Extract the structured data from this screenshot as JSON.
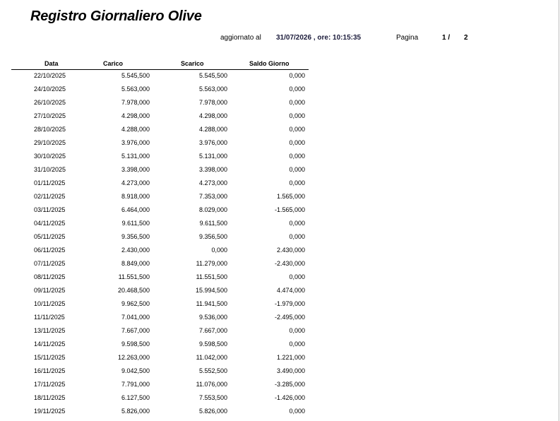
{
  "report": {
    "title": "Registro Giornaliero Olive",
    "updated_label": "aggiornato al",
    "updated_value": "31/07/2026 ,  ore: 10:15:35",
    "page_label": "Pagina",
    "page_current": "1 /",
    "page_total": "2"
  },
  "table": {
    "headers": [
      "Data",
      "Carico",
      "Scarico",
      "Saldo Giorno"
    ],
    "rows": [
      [
        "22/10/2025",
        "5.545,500",
        "5.545,500",
        "0,000"
      ],
      [
        "24/10/2025",
        "5.563,000",
        "5.563,000",
        "0,000"
      ],
      [
        "26/10/2025",
        "7.978,000",
        "7.978,000",
        "0,000"
      ],
      [
        "27/10/2025",
        "4.298,000",
        "4.298,000",
        "0,000"
      ],
      [
        "28/10/2025",
        "4.288,000",
        "4.288,000",
        "0,000"
      ],
      [
        "29/10/2025",
        "3.976,000",
        "3.976,000",
        "0,000"
      ],
      [
        "30/10/2025",
        "5.131,000",
        "5.131,000",
        "0,000"
      ],
      [
        "31/10/2025",
        "3.398,000",
        "3.398,000",
        "0,000"
      ],
      [
        "01/11/2025",
        "4.273,000",
        "4.273,000",
        "0,000"
      ],
      [
        "02/11/2025",
        "8.918,000",
        "7.353,000",
        "1.565,000"
      ],
      [
        "03/11/2025",
        "6.464,000",
        "8.029,000",
        "-1.565,000"
      ],
      [
        "04/11/2025",
        "9.611,500",
        "9.611,500",
        "0,000"
      ],
      [
        "05/11/2025",
        "9.356,500",
        "9.356,500",
        "0,000"
      ],
      [
        "06/11/2025",
        "2.430,000",
        "0,000",
        "2.430,000"
      ],
      [
        "07/11/2025",
        "8.849,000",
        "11.279,000",
        "-2.430,000"
      ],
      [
        "08/11/2025",
        "11.551,500",
        "11.551,500",
        "0,000"
      ],
      [
        "09/11/2025",
        "20.468,500",
        "15.994,500",
        "4.474,000"
      ],
      [
        "10/11/2025",
        "9.962,500",
        "11.941,500",
        "-1.979,000"
      ],
      [
        "11/11/2025",
        "7.041,000",
        "9.536,000",
        "-2.495,000"
      ],
      [
        "13/11/2025",
        "7.667,000",
        "7.667,000",
        "0,000"
      ],
      [
        "14/11/2025",
        "9.598,500",
        "9.598,500",
        "0,000"
      ],
      [
        "15/11/2025",
        "12.263,000",
        "11.042,000",
        "1.221,000"
      ],
      [
        "16/11/2025",
        "9.042,500",
        "5.552,500",
        "3.490,000"
      ],
      [
        "17/11/2025",
        "7.791,000",
        "11.076,000",
        "-3.285,000"
      ],
      [
        "18/11/2025",
        "6.127,500",
        "7.553,500",
        "-1.426,000"
      ],
      [
        "19/11/2025",
        "5.826,000",
        "5.826,000",
        "0,000"
      ]
    ]
  }
}
